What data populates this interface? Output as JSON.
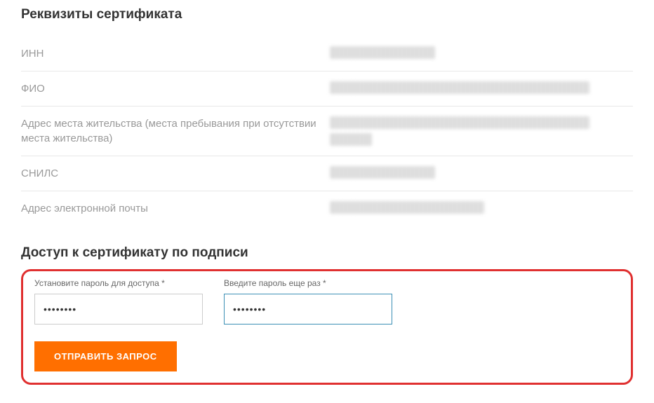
{
  "certificate": {
    "title": "Реквизиты сертификата",
    "rows": [
      {
        "label": "ИНН",
        "value": "████████████"
      },
      {
        "label": "ФИО",
        "value": "████████████████████████████████"
      },
      {
        "label": "Адрес места жительства (места пребывания при отсутствии места жительства)",
        "value": "████████████████████████████████\n█████"
      },
      {
        "label": "СНИЛС",
        "value": "████████████"
      },
      {
        "label": "Адрес электронной почты",
        "value": "██████████████████"
      }
    ]
  },
  "access": {
    "title": "Доступ к сертификату по подписи",
    "password1_label": "Установите пароль для доступа *",
    "password2_label": "Введите пароль еще раз *",
    "password1_value": "••••••••",
    "password2_value": "••••••••",
    "submit_label": "ОТПРАВИТЬ ЗАПРОС"
  }
}
